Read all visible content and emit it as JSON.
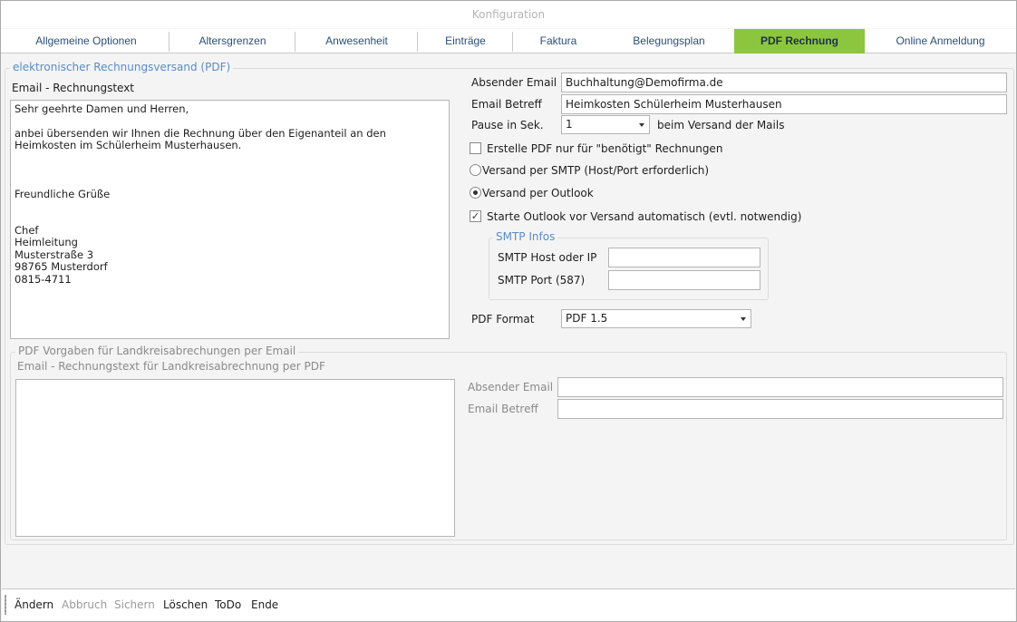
{
  "window": {
    "title": "Konfiguration"
  },
  "tabs": [
    {
      "label": "Allgemeine Optionen"
    },
    {
      "label": "Altersgrenzen"
    },
    {
      "label": "Anwesenheit"
    },
    {
      "label": "Einträge"
    },
    {
      "label": "Faktura"
    },
    {
      "label": "Belegungsplan"
    },
    {
      "label": "PDF Rechnung",
      "active": true
    },
    {
      "label": "Online Anmeldung"
    }
  ],
  "colors": {
    "accent": "#8cc63e",
    "group_title": "#5a8cc8",
    "tab_text": "#2b4f7c"
  },
  "pdf_group": {
    "title": "elektronischer Rechnungsversand (PDF)",
    "email_text_label": "Email - Rechnungstext",
    "email_text": "Sehr geehrte Damen und Herren,\n\nanbei übersenden wir Ihnen die Rechnung über den Eigenanteil an den Heimkosten im Schülerheim Musterhausen.\n\n\n\nFreundliche Grüße\n\n\nChef\nHeimleitung\nMusterstraße 3\n98765 Musterdorf\n0815-4711",
    "sender_label": "Absender Email",
    "sender_value": "Buchhaltung@Demofirma.de",
    "subject_label": "Email Betreff",
    "subject_value": "Heimkosten Schülerheim Musterhausen",
    "pause_label": "Pause in Sek.",
    "pause_value": "1",
    "pause_suffix": "beim Versand der Mails",
    "only_needed_label": "Erstelle PDF nur für \"benötigt\" Rechnungen",
    "only_needed_checked": false,
    "smtp_radio_label": "Versand per SMTP (Host/Port erforderlich)",
    "outlook_radio_label": "Versand per Outlook",
    "send_method": "outlook",
    "auto_outlook_label": "Starte Outlook vor Versand automatisch (evtl. notwendig)",
    "auto_outlook_checked": true,
    "smtp_group": {
      "title": "SMTP Infos",
      "host_label": "SMTP Host oder IP",
      "host_value": "",
      "port_label": "SMTP Port (587)",
      "port_value": ""
    },
    "format_label": "PDF Format",
    "format_value": "PDF 1.5"
  },
  "district_group": {
    "title": "PDF Vorgaben für Landkreisabrechungen per Email",
    "email_text_label": "Email - Rechnungstext für Landkreisabrechnung per PDF",
    "email_text": "",
    "sender_label": "Absender Email",
    "sender_value": "",
    "subject_label": "Email Betreff",
    "subject_value": ""
  },
  "bottom_bar": {
    "change": "Ändern",
    "cancel": "Abbruch",
    "save": "Sichern",
    "delete": "Löschen",
    "todo": "ToDo",
    "end": "Ende"
  }
}
